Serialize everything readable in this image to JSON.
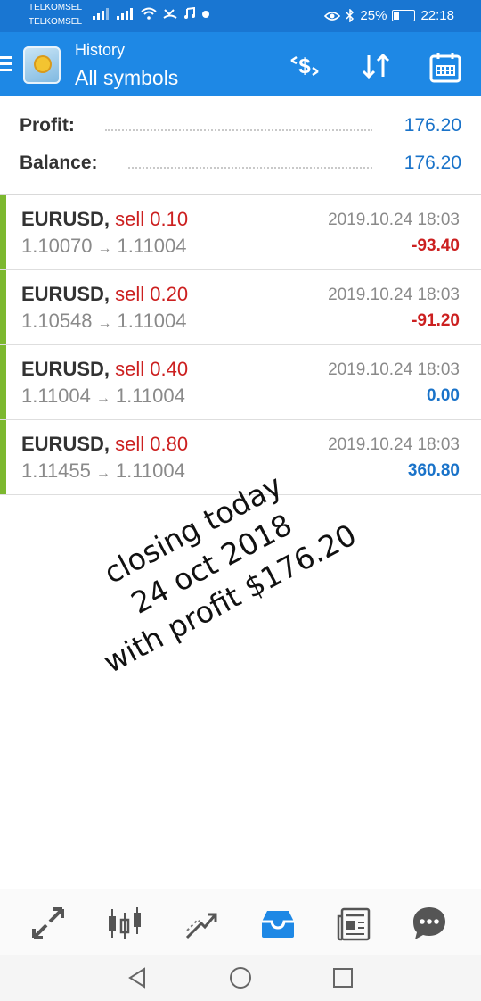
{
  "status_bar": {
    "carrier1": "TELKOMSEL",
    "carrier2": "TELKOMSEL",
    "battery": "25%",
    "time": "22:18",
    "battery_level": 0.25
  },
  "header": {
    "subtitle": "History",
    "title": "All symbols",
    "icons": [
      "menu-icon",
      "app-logo",
      "deposit-withdraw-icon",
      "sort-icon",
      "calendar-icon"
    ]
  },
  "summary": {
    "profit_label": "Profit:",
    "profit_value": "176.20",
    "balance_label": "Balance:",
    "balance_value": "176.20"
  },
  "deals": [
    {
      "symbol": "EURUSD,",
      "side": "sell 0.10",
      "open": "1.10070",
      "close": "1.11004",
      "time": "2019.10.24 18:03",
      "profit": "-93.40",
      "sign": "neg"
    },
    {
      "symbol": "EURUSD,",
      "side": "sell 0.20",
      "open": "1.10548",
      "close": "1.11004",
      "time": "2019.10.24 18:03",
      "profit": "-91.20",
      "sign": "neg"
    },
    {
      "symbol": "EURUSD,",
      "side": "sell 0.40",
      "open": "1.11004",
      "close": "1.11004",
      "time": "2019.10.24 18:03",
      "profit": "0.00",
      "sign": "pos"
    },
    {
      "symbol": "EURUSD,",
      "side": "sell 0.80",
      "open": "1.11455",
      "close": "1.11004",
      "time": "2019.10.24 18:03",
      "profit": "360.80",
      "sign": "pos"
    }
  ],
  "arrow": "→",
  "note": {
    "line1": "closing today",
    "line2": "24 oct 2018",
    "line3": "with profit $176.20"
  },
  "bottom_nav": [
    "quotes-icon",
    "chart-icon",
    "trade-icon",
    "history-icon",
    "news-icon",
    "chat-icon"
  ],
  "colors": {
    "accent": "#1e88e5",
    "profit_positive": "#1a73c9",
    "profit_negative": "#cc2020",
    "deal_bar": "#7cb82f"
  }
}
